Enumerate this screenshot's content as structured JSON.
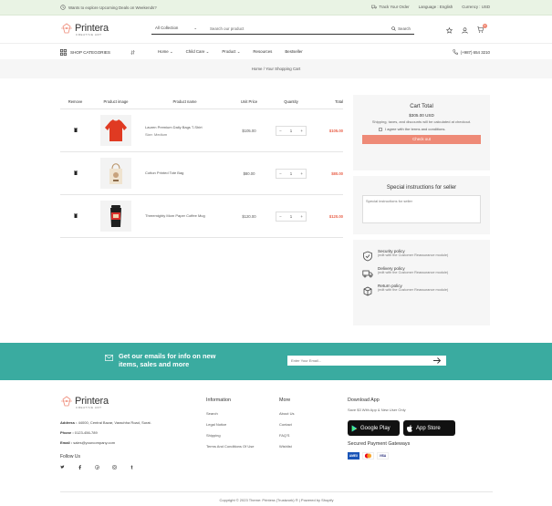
{
  "topbar": {
    "announcement": "Wants to explore Upcoming Deals on Weekends?",
    "track_order": "Track Your Order",
    "language": "Language : English",
    "currency": "Currency : USD"
  },
  "header": {
    "logo_word": "Printera",
    "logo_sub": "CREATIVE ART",
    "search_category": "All Collection",
    "search_placeholder": "Search our product",
    "search_button": "Search",
    "cart_count": "0"
  },
  "nav": {
    "categories_label": "SHOP CATEGORIES",
    "menu": [
      {
        "label": "Home",
        "caret": "⌄"
      },
      {
        "label": "Child Care",
        "caret": "⌄"
      },
      {
        "label": "Product",
        "caret": "⌄"
      },
      {
        "label": "Resources",
        "caret": ""
      },
      {
        "label": "Bestseller",
        "caret": ""
      }
    ],
    "phone": "(+987) 654 3210"
  },
  "breadcrumb": {
    "home": "Home",
    "separator": "/",
    "current": "Your Shopping Cart"
  },
  "cart": {
    "headers": {
      "remove": "Remove",
      "image": "Product image",
      "name": "Product name",
      "price": "Unit Price",
      "quantity": "Quantity",
      "total": "Total"
    },
    "rows": [
      {
        "name": "Lauren Premium Daily Bags T-Shirt",
        "variant": "Size: Medium",
        "price": "$105.00",
        "qty": "1",
        "total": "$105.00"
      },
      {
        "name": "Cotton Printed Tote Bag",
        "variant": "",
        "price": "$80.00",
        "qty": "1",
        "total": "$80.00"
      },
      {
        "name": "Threemighty Mom Paper Coffee Mug",
        "variant": "",
        "price": "$120.00",
        "qty": "1",
        "total": "$120.00"
      }
    ]
  },
  "summary": {
    "title": "Cart Total",
    "amount": "$305.00 USD",
    "note": "Shipping, taxes, and discounts will be calculated at checkout.",
    "agree": "I agree with the terms and conditions.",
    "checkout": "Check out"
  },
  "instructions": {
    "title": "Special instructions for seller",
    "placeholder": "Special instructions for seller"
  },
  "policies": [
    {
      "title": "Security policy",
      "desc": "(edit with the Customer Reassurance module)"
    },
    {
      "title": "Delivery policy",
      "desc": "(edit with the Customer Reassurance module)"
    },
    {
      "title": "Return policy",
      "desc": "(edit with the Customer Reassurance module)"
    }
  ],
  "newsletter": {
    "line1": "Get our emails for info on new",
    "line2": "items, sales and more",
    "placeholder": "Enter Your Email..."
  },
  "footer": {
    "address_label": "Address :",
    "address": "44000, Central Bazar, Varachha Road, Surat.",
    "phone_label": "Phone :",
    "phone": "0123-456-789",
    "email_label": "Email :",
    "email": "sales@yourcompany.com",
    "follow": "Follow Us",
    "info_title": "Information",
    "info_links": [
      "Search",
      "Legal Notice",
      "Shipping",
      "Terms And Conditions Of Use"
    ],
    "more_title": "More",
    "more_links": [
      "About Us",
      "Contact",
      "FAQ'S",
      "Wishlist"
    ],
    "app_title": "Download App",
    "app_sub": "Save $3 With App & New User Only",
    "google_play": "Google Play",
    "app_store": "App Store",
    "payment_title": "Secured Payment Gateways",
    "copyright": "Copyright © 2023 Theme: Printera (Trustwork) ® | Powered by Shopify"
  },
  "colors": {
    "accent": "#ee8a77",
    "teal": "#3aaba0",
    "topbar": "#e9f3e4"
  }
}
